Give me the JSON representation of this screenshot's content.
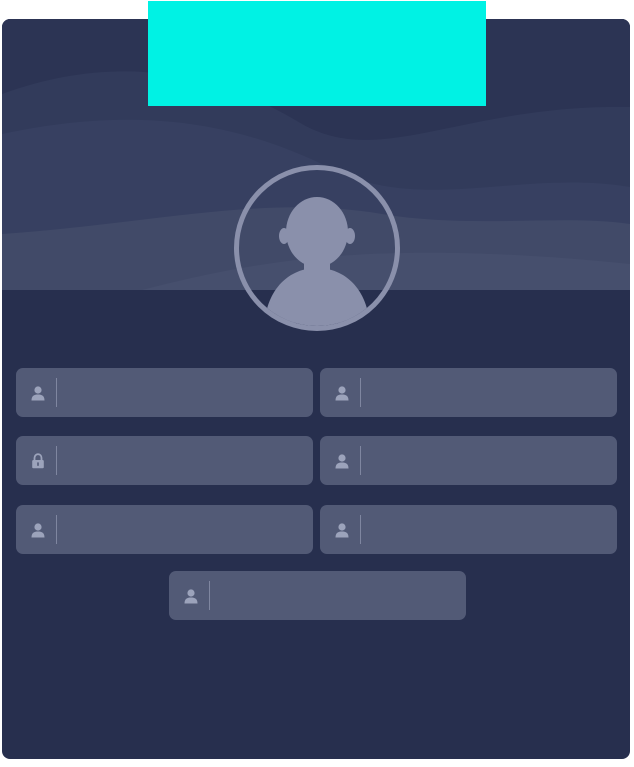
{
  "colors": {
    "page_background": "#ffffff",
    "card_background": "#272f4e",
    "header_band": "#2c3454",
    "tab_accent": "#00f2e4",
    "field_background": "#525a76",
    "icon_color": "#9ca3bb",
    "avatar_color": "#8a90ab"
  },
  "header": {
    "tab_label": ""
  },
  "avatar": {
    "icon": "user-avatar-icon"
  },
  "form": {
    "fields": [
      {
        "icon": "user-icon",
        "value": "",
        "placeholder": ""
      },
      {
        "icon": "user-icon",
        "value": "",
        "placeholder": ""
      },
      {
        "icon": "lock-icon",
        "value": "",
        "placeholder": ""
      },
      {
        "icon": "user-icon",
        "value": "",
        "placeholder": ""
      },
      {
        "icon": "user-icon",
        "value": "",
        "placeholder": ""
      },
      {
        "icon": "user-icon",
        "value": "",
        "placeholder": ""
      },
      {
        "icon": "user-icon",
        "value": "",
        "placeholder": ""
      }
    ]
  }
}
